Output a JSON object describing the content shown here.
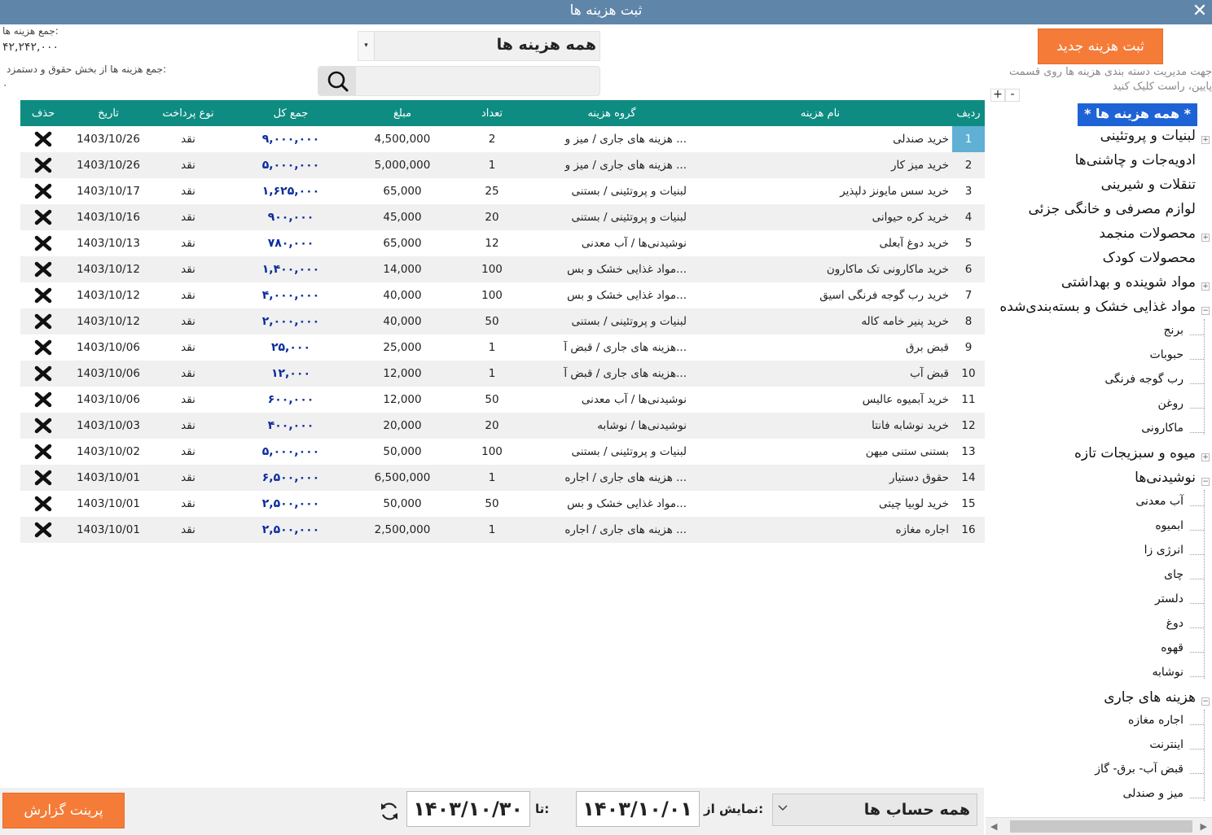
{
  "window": {
    "title": "ثبت هزینه ها",
    "close_glyph": "✕"
  },
  "summary": {
    "total_label": "جمع هزینه ها:",
    "total_value": "۴۲,۲۴۲,۰۰۰",
    "payroll_label": "جمع هزینه ها از بخش حقوق و دستمزد:",
    "payroll_value": "۰"
  },
  "filter": {
    "group_value": "همه هزینه ها",
    "search_placeholder": ""
  },
  "table": {
    "headers": {
      "row": "ردیف",
      "name": "نام هزینه",
      "group": "گروه هزینه",
      "count": "تعداد",
      "amount": "مبلغ",
      "total": "جمع کل",
      "pay_type": "نوع پرداخت",
      "date": "تاریخ",
      "delete": "حذف"
    },
    "rows": [
      {
        "row": "1",
        "name": "خرید صندلی",
        "group": "هزینه های جاری / میز و ...",
        "count": "2",
        "amount": "4,500,000",
        "total": "۹,۰۰۰,۰۰۰",
        "pay_type": "نقد",
        "date": "1403/10/26"
      },
      {
        "row": "2",
        "name": "خرید میز کار",
        "group": "هزینه های جاری / میز و ...",
        "count": "1",
        "amount": "5,000,000",
        "total": "۵,۰۰۰,۰۰۰",
        "pay_type": "نقد",
        "date": "1403/10/26"
      },
      {
        "row": "3",
        "name": "خرید سس مایونز دلپذیر",
        "group": "لبنیات و پروتئینی / بستنی",
        "count": "25",
        "amount": "65,000",
        "total": "۱,۶۲۵,۰۰۰",
        "pay_type": "نقد",
        "date": "1403/10/17"
      },
      {
        "row": "4",
        "name": "خرید کره حیوانی",
        "group": "لبنیات و پروتئینی / بستنی",
        "count": "20",
        "amount": "45,000",
        "total": "۹۰۰,۰۰۰",
        "pay_type": "نقد",
        "date": "1403/10/16"
      },
      {
        "row": "5",
        "name": "خرید دوغ آبعلی",
        "group": "نوشیدنی‌ها / آب معدنی",
        "count": "12",
        "amount": "65,000",
        "total": "۷۸۰,۰۰۰",
        "pay_type": "نقد",
        "date": "1403/10/13"
      },
      {
        "row": "6",
        "name": "خرید ماکارونی تک ماکارون",
        "group": "مواد غذایی خشک و بس...",
        "count": "100",
        "amount": "14,000",
        "total": "۱,۴۰۰,۰۰۰",
        "pay_type": "نقد",
        "date": "1403/10/12"
      },
      {
        "row": "7",
        "name": "خرید رب گوجه فرنگی اسیق",
        "group": "مواد غذایی خشک و بس...",
        "count": "100",
        "amount": "40,000",
        "total": "۴,۰۰۰,۰۰۰",
        "pay_type": "نقد",
        "date": "1403/10/12"
      },
      {
        "row": "8",
        "name": "خرید پنیر خامه کاله",
        "group": "لبنیات و پروتئینی / بستنی",
        "count": "50",
        "amount": "40,000",
        "total": "۲,۰۰۰,۰۰۰",
        "pay_type": "نقد",
        "date": "1403/10/12"
      },
      {
        "row": "9",
        "name": "قبض برق",
        "group": "هزینه های جاری / قبض آ...",
        "count": "1",
        "amount": "25,000",
        "total": "۲۵,۰۰۰",
        "pay_type": "نقد",
        "date": "1403/10/06"
      },
      {
        "row": "10",
        "name": "قبض آب",
        "group": "هزینه های جاری / قبض آ...",
        "count": "1",
        "amount": "12,000",
        "total": "۱۲,۰۰۰",
        "pay_type": "نقد",
        "date": "1403/10/06"
      },
      {
        "row": "11",
        "name": "خرید آبمیوه عالیس",
        "group": "نوشیدنی‌ها / آب معدنی",
        "count": "50",
        "amount": "12,000",
        "total": "۶۰۰,۰۰۰",
        "pay_type": "نقد",
        "date": "1403/10/06"
      },
      {
        "row": "12",
        "name": "خرید نوشابه فانتا",
        "group": "نوشیدنی‌ها / نوشابه",
        "count": "20",
        "amount": "20,000",
        "total": "۴۰۰,۰۰۰",
        "pay_type": "نقد",
        "date": "1403/10/03"
      },
      {
        "row": "13",
        "name": "بستنی ستنی میهن",
        "group": "لبنیات و پروتئینی / بستنی",
        "count": "100",
        "amount": "50,000",
        "total": "۵,۰۰۰,۰۰۰",
        "pay_type": "نقد",
        "date": "1403/10/02"
      },
      {
        "row": "14",
        "name": "حقوق دستیار",
        "group": "هزینه های جاری / اجاره ...",
        "count": "1",
        "amount": "6,500,000",
        "total": "۶,۵۰۰,۰۰۰",
        "pay_type": "نقد",
        "date": "1403/10/01"
      },
      {
        "row": "15",
        "name": "خرید لوبیا چیتی",
        "group": "مواد غذایی خشک و بس...",
        "count": "50",
        "amount": "50,000",
        "total": "۲,۵۰۰,۰۰۰",
        "pay_type": "نقد",
        "date": "1403/10/01"
      },
      {
        "row": "16",
        "name": "اجاره مغازه",
        "group": "هزینه های جاری / اجاره ...",
        "count": "1",
        "amount": "2,500,000",
        "total": "۲,۵۰۰,۰۰۰",
        "pay_type": "نقد",
        "date": "1403/10/01"
      }
    ]
  },
  "bottom": {
    "print_label": "پرینت گزارش",
    "to_label": "تا:",
    "to_date": "۱۴۰۳/۱۰/۳۰",
    "from_label": "نمایش از:",
    "from_date": "۱۴۰۳/۱۰/۰۱",
    "account_value": "همه حساب ها"
  },
  "sidebar": {
    "new_expense_label": "ثبت هزینه جدید",
    "hint": "جهت مدیریت دسته بندی هزینه ها روی قسمت پایین، راست کلیک کنید",
    "expand_all": "+",
    "collapse_all": "-",
    "root": "* همه هزینه ها *",
    "categories": {
      "dairy": "لبنیات و پروتئینی",
      "spices": "ادویه‌جات و چاشنی‌ها",
      "snacks": "تنقلات و شیرینی",
      "household": "لوازم مصرفی و خانگی جزئی",
      "frozen": "محصولات منجمد",
      "baby": "محصولات کودک",
      "cleaning": "مواد شوینده و بهداشتی",
      "dry_food": "مواد غذایی خشک و بسته‌بندی‌شده",
      "fruits": "میوه و سبزیجات تازه",
      "drinks": "نوشیدنی‌ها",
      "current": "هزینه های جاری"
    },
    "dry_food_children": [
      "برنج",
      "حبوبات",
      "رب گوجه فرنگی",
      "روغن",
      "ماکارونی"
    ],
    "drinks_children": [
      "آب معدنی",
      "ابمیوه",
      "انرژی زا",
      "چای",
      "دلستر",
      "دوغ",
      "قهوه",
      "نوشابه"
    ],
    "current_children": [
      "اجاره مغازه",
      "اینترنت",
      "قبض آب- برق- گاز",
      "میز و صندلی"
    ]
  },
  "colors": {
    "titlebar": "#5f86a8",
    "header": "#0e8c82",
    "accent_orange": "#f57c38",
    "root_selected": "#1e63d6",
    "total_text": "#0a2c9c",
    "row_selected": "#5fb0d4"
  }
}
